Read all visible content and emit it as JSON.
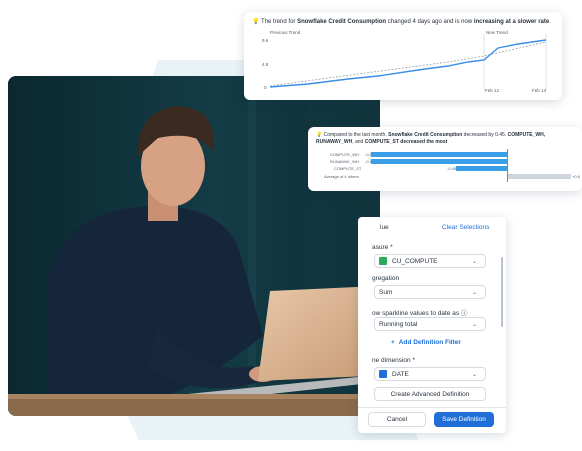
{
  "trend_card": {
    "insight_prefix": "The trend for ",
    "insight_metric": "Snowflake Credit Consumption",
    "insight_middle": " changed 4 days ago and is now ",
    "insight_bold": "increasing at a slower rate",
    "insight_end": ".",
    "previous_label": "Previous Trend",
    "new_label": "New Trend",
    "y_ticks": [
      "9.6",
      "4.8",
      "0"
    ],
    "x_ticks": [
      "Feb 12",
      "Feb 13"
    ]
  },
  "compare_card": {
    "text_prefix": "Compared to the last month, ",
    "text_metric": "Snowflake Credit Consumption",
    "text_mid": " decreased by 0.45. ",
    "text_items": "COMPUTE_WH, RUNAWAY_WH",
    "text_and": ", and ",
    "text_last": "COMPUTE_ST",
    "text_end": " decreased the most",
    "rows": [
      {
        "label": "COMPUTE_WH",
        "value": "-0.1"
      },
      {
        "label": "RUNAWAY_WH",
        "value": "-0.1"
      },
      {
        "label": "COMPUTE_ST",
        "value": "-0.45"
      },
      {
        "label": "Average of 4 others",
        "value": "+0.6"
      }
    ]
  },
  "definition_panel": {
    "header_value": "lue",
    "clear_label": "Clear Selections",
    "measure_label": "asure *",
    "measure_value": "CU_COMPUTE",
    "aggregation_label": "gregation",
    "aggregation_value": "Sum",
    "sparkline_label": "ow sparkline values to date as ⓘ",
    "sparkline_value": "Running total",
    "add_filter_label": "Add Definition Filter",
    "time_dim_label": "ne dimension *",
    "time_dim_value": "DATE",
    "advanced_label": "Create Advanced Definition",
    "cancel_label": "Cancel",
    "save_label": "Save Definition"
  },
  "colors": {
    "accent": "#1f6fd6",
    "line": "#3a8ee6",
    "bar": "#3a9ee8",
    "grey_bar": "#cfd5dc"
  },
  "icons": {
    "insight": "lightbulb-icon",
    "measure": "grid-icon",
    "date": "calendar-icon",
    "chevron": "chevron-down-icon",
    "add": "plus-icon"
  }
}
